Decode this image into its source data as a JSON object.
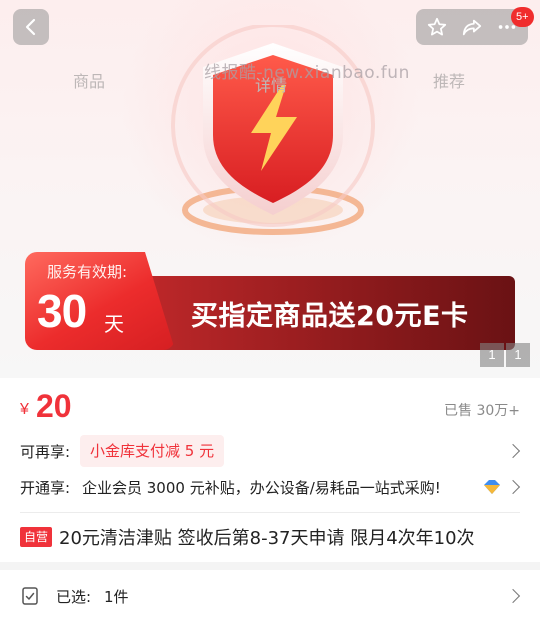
{
  "header": {
    "back_icon": "chevron-left-icon",
    "actions": [
      "star-icon",
      "share-icon",
      "more-icon"
    ],
    "notification_badge": "5+",
    "tabs": [
      "商品",
      "详情",
      "推荐"
    ],
    "watermark": "线报酷-new.xianbao.fun"
  },
  "banner": {
    "shield_icon": "lightning-shield-icon",
    "validity_label": "服务有效期:",
    "validity_value": "30",
    "validity_unit": "天",
    "promo_text": "买指定商品送20元E卡",
    "page_current": "1",
    "page_total": "1"
  },
  "price": {
    "currency": "¥",
    "value": "20",
    "sold": "已售 30万+"
  },
  "offers": {
    "enjoy_label": "可再享:",
    "enjoy_pill": "小金库支付减 5 元",
    "open_label": "开通享:",
    "open_text": "企业会员 3000 元补贴，办公设备/易耗品一站式采购!"
  },
  "service": {
    "self_tag": "自营",
    "text": "20元清洁津贴 签收后第8-37天申请 限月4次年10次"
  },
  "selection": {
    "label": "已选:",
    "value": "1件"
  },
  "colors": {
    "accent": "#f0323a",
    "banner_dark": "#8c1a1c"
  }
}
